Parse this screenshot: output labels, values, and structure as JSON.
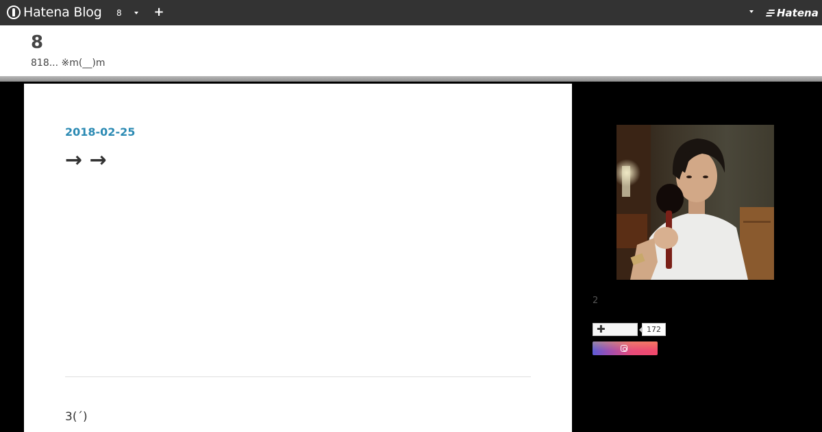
{
  "topbar": {
    "brand_label": "Hatena Blog",
    "blog_switch_label": "8",
    "new_post_label": "+",
    "hatena_logo_label": "Hatena"
  },
  "header": {
    "title": "8",
    "description": "818... ※m(__)m"
  },
  "entry": {
    "date": "2018-02-25",
    "title": "→ →",
    "body": "3(´)"
  },
  "sidebar": {
    "profile_name": "2",
    "subscribe_count": "172"
  },
  "colors": {
    "topbar_bg": "#333333",
    "date_link": "#2b8ab3",
    "page_bg": "#000000"
  },
  "icons": {
    "brand": "hatena-blog-icon",
    "new_post": "plus-icon",
    "subscribe": "plus-icon",
    "instagram": "instagram-icon"
  }
}
